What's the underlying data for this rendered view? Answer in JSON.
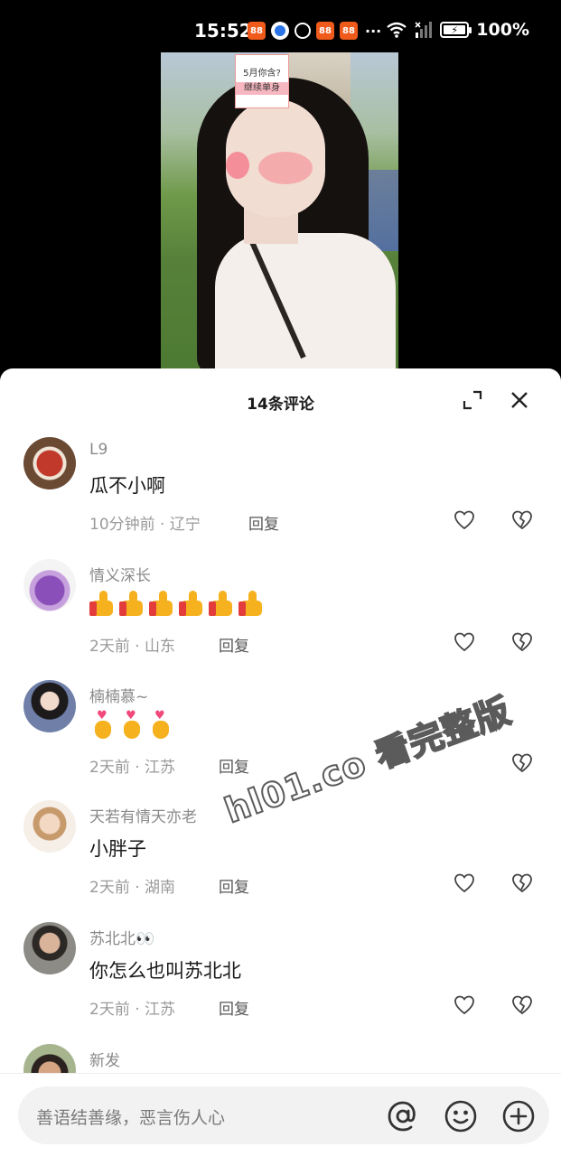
{
  "status_bar": {
    "time": "15:52",
    "notif_app_text": "88",
    "more": "···",
    "battery_pct": "100%"
  },
  "video": {
    "sticker_line1": "5月你含?",
    "sticker_line2": "继续单身"
  },
  "sheet": {
    "title": "14条评论"
  },
  "comments": [
    {
      "user": "L9",
      "text": "瓜不小啊",
      "meta": "10分钟前 · 辽宁",
      "reply": "回复"
    },
    {
      "user": "情义深长",
      "emoji": "thumbs-up-icon x6",
      "meta": "2天前 · 山东",
      "reply": "回复"
    },
    {
      "user": "楠楠慕~",
      "emoji": "finger-heart-icon x3",
      "meta": "2天前 · 江苏",
      "reply": "回复"
    },
    {
      "user": "天若有情天亦老",
      "text": "小胖子",
      "meta": "2天前 · 湖南",
      "reply": "回复"
    },
    {
      "user": "苏北北👀",
      "text": "你怎么也叫苏北北",
      "meta": "2天前 · 江苏",
      "reply": "回复"
    },
    {
      "user": "新发"
    }
  ],
  "watermark": "hl01.co 看完整版",
  "input": {
    "placeholder": "善语结善缘，恶言伤人心"
  },
  "colors": {
    "notif_orange": "#f05a1a",
    "thumb_yellow": "#f6b11e",
    "text_dark": "#1a1a1a",
    "text_gray": "#9a9a9a"
  }
}
